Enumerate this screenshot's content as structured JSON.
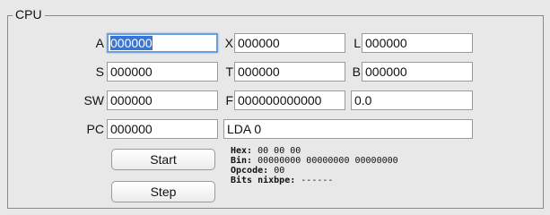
{
  "panel": {
    "title": "CPU"
  },
  "registers": {
    "A": {
      "label": "A",
      "value": "000000"
    },
    "X": {
      "label": "X",
      "value": "000000"
    },
    "L": {
      "label": "L",
      "value": "000000"
    },
    "S": {
      "label": "S",
      "value": "000000"
    },
    "T": {
      "label": "T",
      "value": "000000"
    },
    "B": {
      "label": "B",
      "value": "000000"
    },
    "SW": {
      "label": "SW",
      "value": "000000"
    },
    "F": {
      "label": "F",
      "value": "000000000000"
    },
    "F_float": {
      "value": "0.0"
    },
    "PC": {
      "label": "PC",
      "value": "000000"
    }
  },
  "instruction": {
    "value": "LDA 0"
  },
  "buttons": {
    "start": "Start",
    "step": "Step"
  },
  "info": {
    "hex_label": "Hex:",
    "hex_value": "00 00 00",
    "bin_label": "Bin:",
    "bin_value": "00000000 00000000 00000000",
    "opcode_label": "Opcode:",
    "opcode_value": "00",
    "bits_label": "Bits nixbpe:",
    "bits_value": "------"
  }
}
